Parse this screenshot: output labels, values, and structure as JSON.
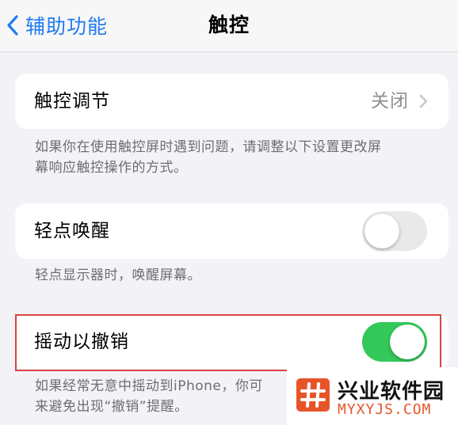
{
  "nav": {
    "back_label": "辅助功能",
    "title": "触控"
  },
  "touch_accommodations": {
    "label": "触控调节",
    "value": "关闭",
    "footnote_line1": "如果你在使用触控屏时遇到问题，请调整以下设置更改屏",
    "footnote_line2": "幕响应触控操作的方式。"
  },
  "tap_to_wake": {
    "label": "轻点唤醒",
    "enabled": false,
    "footnote": "轻点显示器时，唤醒屏幕。"
  },
  "shake_to_undo": {
    "label": "摇动以撤销",
    "enabled": true,
    "footnote_line1": "如果经常无意中摇动到iPhone，你可",
    "footnote_line2": "来避免出现“撤销”提醒。"
  },
  "watermark": {
    "name": "兴业软件园",
    "url": "MYXYJS.COM"
  },
  "colors": {
    "accent_blue": "#1f7bf2",
    "toggle_on": "#34c759",
    "highlight_red": "#d94444",
    "watermark_orange": "#e8542a"
  }
}
